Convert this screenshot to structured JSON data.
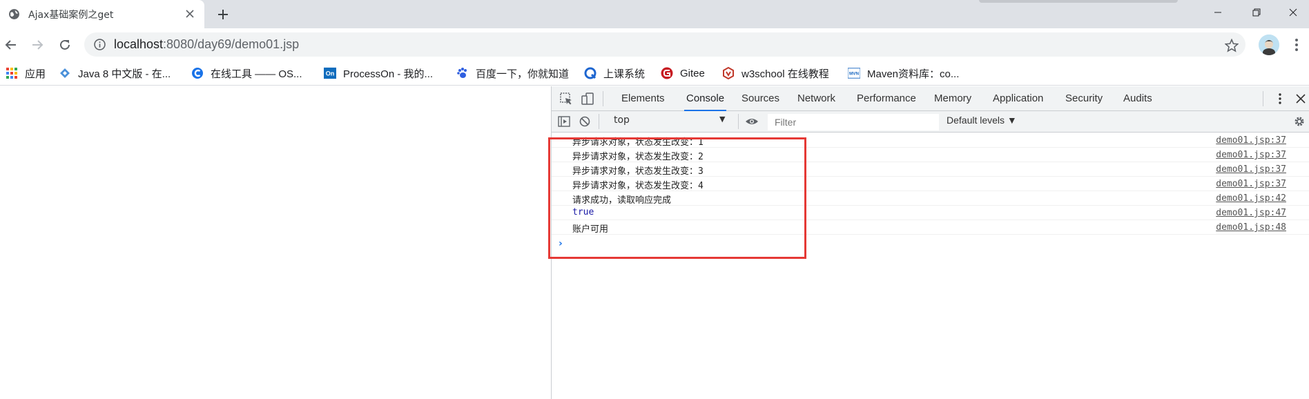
{
  "browser": {
    "tab": {
      "title": "Ajax基础案例之get",
      "favicon": "globe-icon"
    },
    "address": {
      "host": "localhost",
      "port": ":8080",
      "path": "/day69/demo01.jsp"
    },
    "bookmarks": [
      {
        "label": "应用",
        "icon": "apps-grid-icon"
      },
      {
        "label": "Java 8 中文版 - 在...",
        "icon": "java-icon"
      },
      {
        "label": "在线工具 —— OS...",
        "icon": "c-logo-icon"
      },
      {
        "label": "ProcessOn - 我的...",
        "icon": "processon-icon"
      },
      {
        "label": "百度一下，你就知道",
        "icon": "baidu-paw-icon"
      },
      {
        "label": "上课系统",
        "icon": "q-logo-icon"
      },
      {
        "label": "Gitee",
        "icon": "gitee-icon"
      },
      {
        "label": "w3school 在线教程",
        "icon": "w3school-icon"
      },
      {
        "label": "Maven资料库：co...",
        "icon": "mvn-icon"
      }
    ]
  },
  "devtools": {
    "tabs": [
      "Elements",
      "Console",
      "Sources",
      "Network",
      "Performance",
      "Memory",
      "Application",
      "Security",
      "Audits"
    ],
    "active_tab": "Console",
    "toolbar": {
      "context": "top",
      "filter_placeholder": "Filter",
      "levels": "Default levels ▼"
    },
    "console": {
      "messages": [
        {
          "text": "异步请求对象，状态发生改变：1",
          "source": "demo01.jsp:37"
        },
        {
          "text": "异步请求对象，状态发生改变：2",
          "source": "demo01.jsp:37"
        },
        {
          "text": "异步请求对象，状态发生改变：3",
          "source": "demo01.jsp:37"
        },
        {
          "text": "异步请求对象，状态发生改变：4",
          "source": "demo01.jsp:37"
        },
        {
          "text": "请求成功，读取响应完成",
          "source": "demo01.jsp:42"
        },
        {
          "text": "true",
          "source": "demo01.jsp:47"
        },
        {
          "text": "账户可用",
          "source": "demo01.jsp:48"
        }
      ],
      "prompt": "›"
    }
  },
  "colors": {
    "accent": "#1a73e8",
    "highlight": "#e53935",
    "boolean": "#1a1aa6"
  }
}
